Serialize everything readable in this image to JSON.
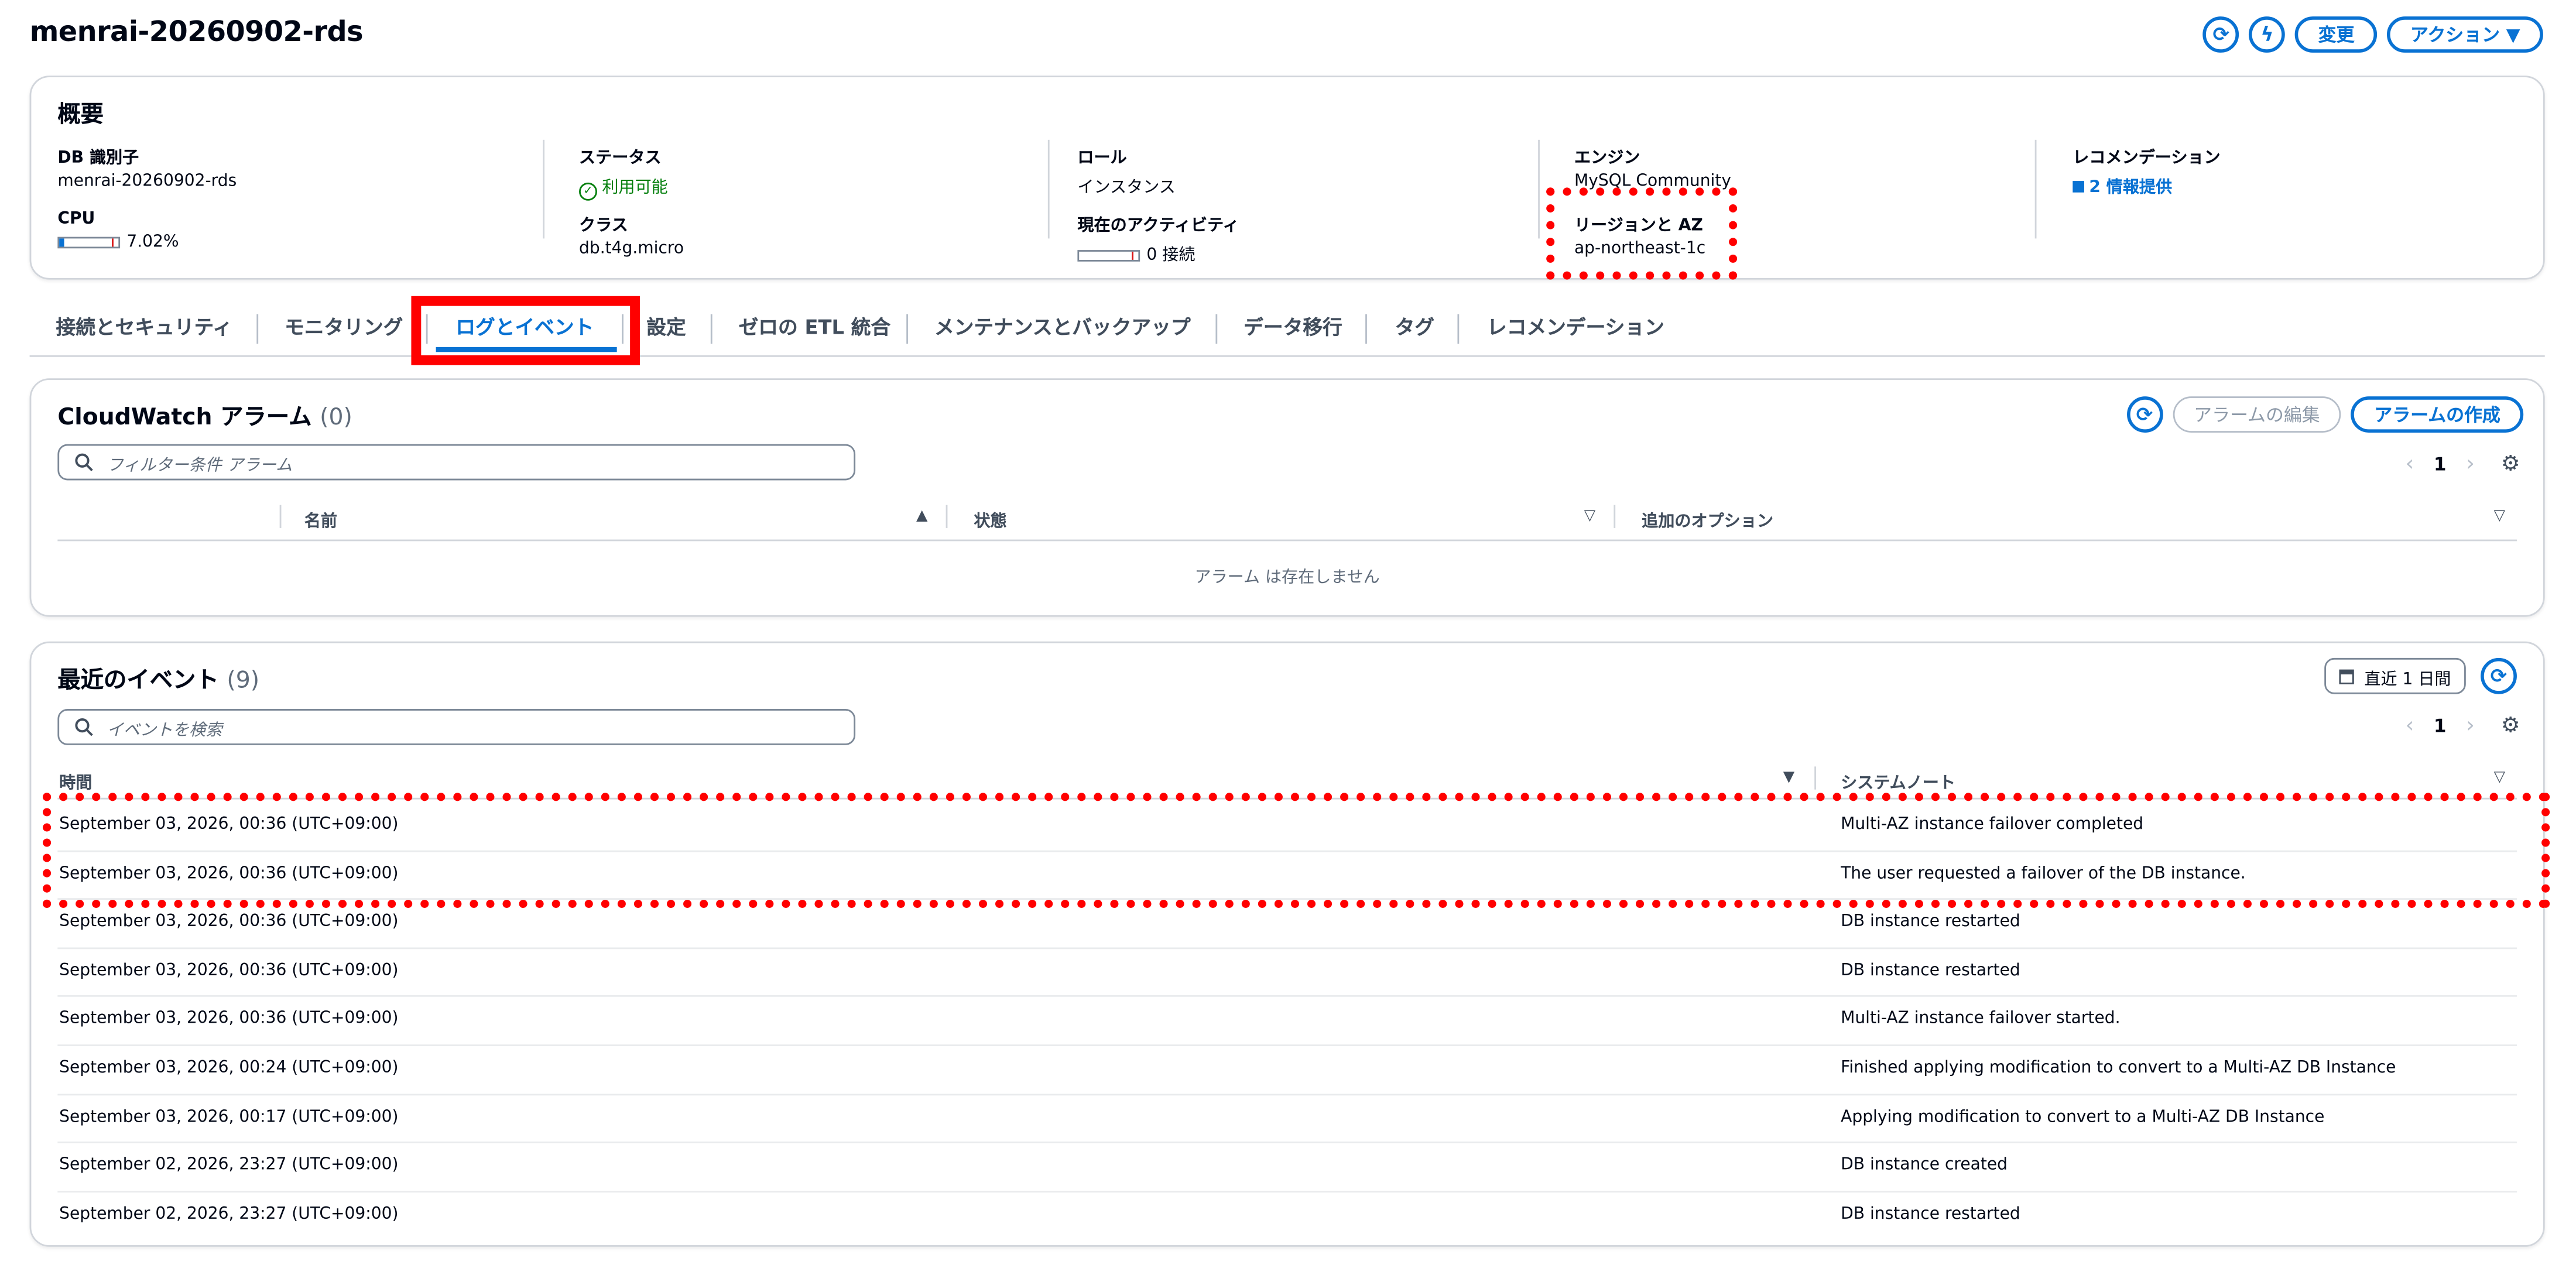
{
  "page": {
    "title": "menrai-20260902-rds",
    "actions": {
      "modify": "変更",
      "actions": "アクション ▼"
    }
  },
  "overview": {
    "title": "概要",
    "db_identifier": {
      "label": "DB 識別子",
      "value": "menrai-20260902-rds"
    },
    "cpu": {
      "label": "CPU",
      "value": "7.02%",
      "level": 0.0702
    },
    "status": {
      "label": "ステータス",
      "value": "利用可能"
    },
    "class": {
      "label": "クラス",
      "value": "db.t4g.micro"
    },
    "role": {
      "label": "ロール",
      "value": "インスタンス"
    },
    "activity": {
      "label": "現在のアクティビティ",
      "value": "0 接続",
      "level": 0
    },
    "engine": {
      "label": "エンジン",
      "value": "MySQL Community"
    },
    "region": {
      "label": "リージョンと AZ",
      "value": "ap-northeast-1c"
    },
    "recommendation": {
      "label": "レコメンデーション",
      "value": "2 情報提供"
    }
  },
  "tabs": [
    {
      "label": "接続とセキュリティ"
    },
    {
      "label": "モニタリング"
    },
    {
      "label": "ログとイベント",
      "active": true
    },
    {
      "label": "設定"
    },
    {
      "label": "ゼロの ETL 統合"
    },
    {
      "label": "メンテナンスとバックアップ"
    },
    {
      "label": "データ移行"
    },
    {
      "label": "タグ"
    },
    {
      "label": "レコメンデーション"
    }
  ],
  "alarms": {
    "title": "CloudWatch アラーム",
    "count": "(0)",
    "edit_label": "アラームの編集",
    "create_label": "アラームの作成",
    "filter_placeholder": "フィルター条件 アラーム",
    "page": "1",
    "columns": [
      "名前",
      "状態",
      "追加のオプション"
    ],
    "empty_message": "アラーム は存在しません"
  },
  "events": {
    "title": "最近のイベント",
    "count": "(9)",
    "date_range": "直近 1 日間",
    "search_placeholder": "イベントを検索",
    "page": "1",
    "columns": [
      "時間",
      "システムノート"
    ],
    "rows": [
      {
        "time": "September 03, 2026, 00:36 (UTC+09:00)",
        "note": "Multi-AZ instance failover completed"
      },
      {
        "time": "September 03, 2026, 00:36 (UTC+09:00)",
        "note": "The user requested a failover of the DB instance."
      },
      {
        "time": "September 03, 2026, 00:36 (UTC+09:00)",
        "note": "DB instance restarted"
      },
      {
        "time": "September 03, 2026, 00:36 (UTC+09:00)",
        "note": "DB instance restarted"
      },
      {
        "time": "September 03, 2026, 00:36 (UTC+09:00)",
        "note": "Multi-AZ instance failover started."
      },
      {
        "time": "September 03, 2026, 00:24 (UTC+09:00)",
        "note": "Finished applying modification to convert to a Multi-AZ DB Instance"
      },
      {
        "time": "September 03, 2026, 00:17 (UTC+09:00)",
        "note": "Applying modification to convert to a Multi-AZ DB Instance"
      },
      {
        "time": "September 02, 2026, 23:27 (UTC+09:00)",
        "note": "DB instance created"
      },
      {
        "time": "September 02, 2026, 23:27 (UTC+09:00)",
        "note": "DB instance restarted"
      }
    ]
  },
  "colors": {
    "accent": "#0972d3",
    "success": "#037f0c",
    "annotation": "#ff0000"
  }
}
